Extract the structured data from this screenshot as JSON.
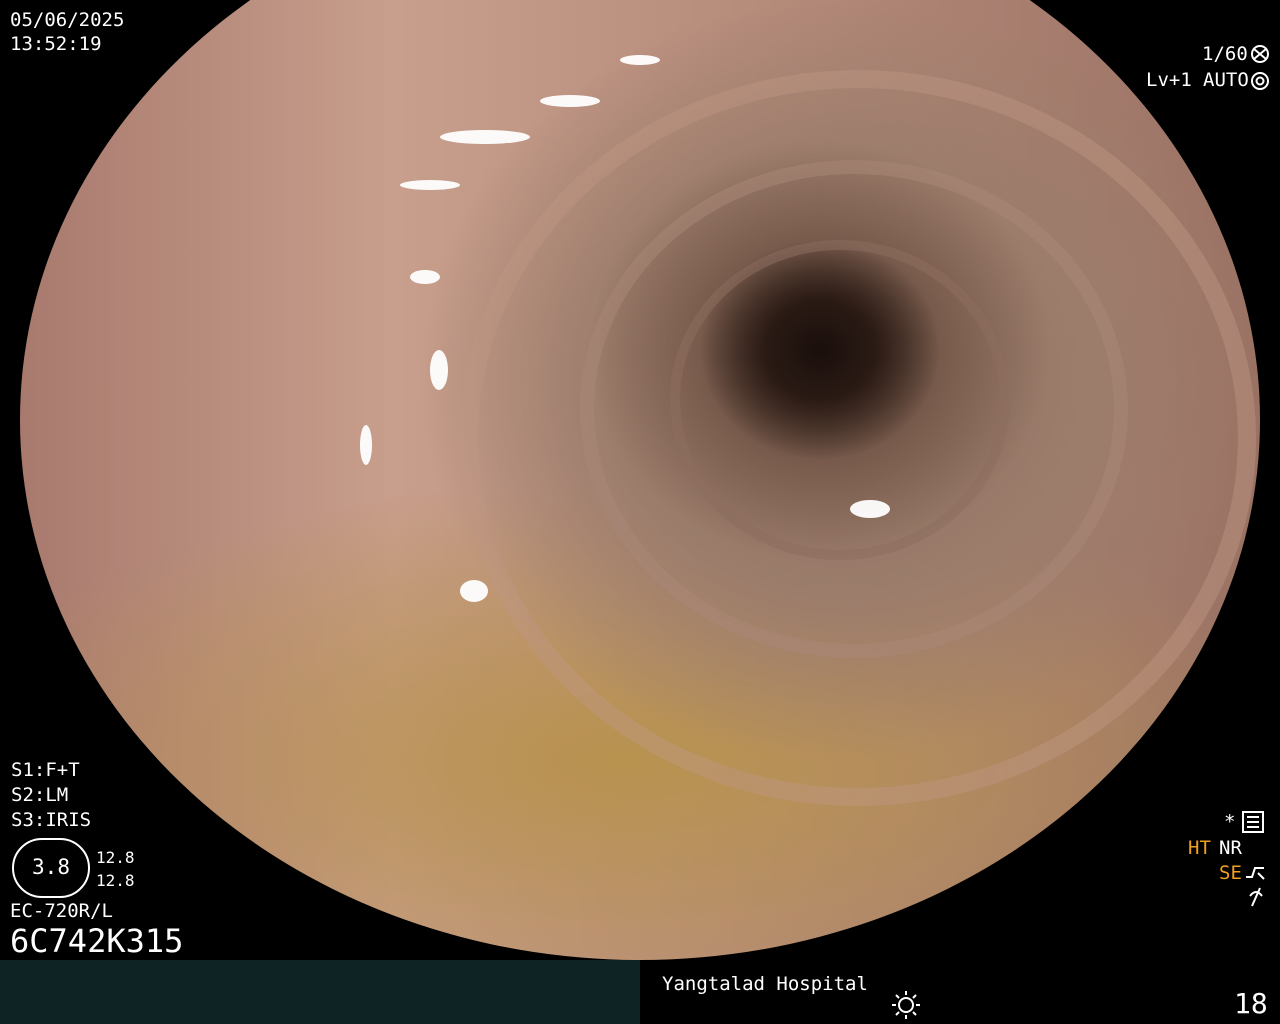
{
  "overlay": {
    "date": "05/06/2025",
    "time": "13:52:19",
    "shutter": "1/60",
    "level": "Lv+1",
    "iris_mode": "AUTO",
    "settings": [
      "S1:F+T",
      "S2:LM",
      "S3:IRIS"
    ],
    "gauge_value": "3.8",
    "gauge_readout_1": "12.8",
    "gauge_readout_2": "12.8",
    "scope_model": "EC-720R/L",
    "scope_serial": "6C742K315",
    "right_flags": {
      "asterisk": "*",
      "ht": "HT",
      "nr": "NR",
      "se": "SE"
    },
    "hospital": "Yangtalad Hospital",
    "image_count": "18"
  },
  "icons": {
    "shutter": "shutter-icon",
    "iris": "iris-icon",
    "settings": "settings-icon",
    "se": "se-curve-icon",
    "freeze": "freeze-icon",
    "light": "light-icon"
  },
  "colors": {
    "accent_orange": "#f0a020",
    "bar_bg": "#0e2424"
  }
}
